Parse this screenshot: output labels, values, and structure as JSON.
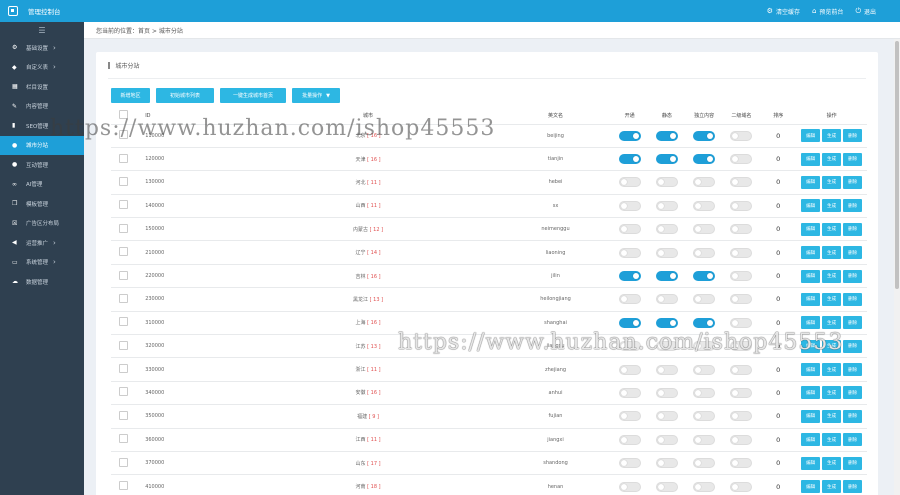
{
  "app": {
    "title": "管理控制台"
  },
  "top": {
    "items": [
      {
        "icon": "gear-icon",
        "label": "清空缓存"
      },
      {
        "icon": "home-icon",
        "label": "预览前台"
      },
      {
        "icon": "power-icon",
        "label": "退出"
      }
    ]
  },
  "sidebar": {
    "items": [
      {
        "icon": "gear-icon",
        "label": "基础设置",
        "arrow": true,
        "active": false
      },
      {
        "icon": "tag-icon",
        "label": "自定义表",
        "arrow": true,
        "active": false
      },
      {
        "icon": "grid-icon",
        "label": "栏目设置",
        "arrow": false,
        "active": false
      },
      {
        "icon": "edit-icon",
        "label": "内容管理",
        "arrow": false,
        "active": false
      },
      {
        "icon": "chart-icon",
        "label": "SEO管理",
        "arrow": false,
        "active": false
      },
      {
        "icon": "globe-icon",
        "label": "城市分站",
        "arrow": false,
        "active": true
      },
      {
        "icon": "comment-icon",
        "label": "互动管理",
        "arrow": false,
        "active": false
      },
      {
        "icon": "link-icon",
        "label": "AI管理",
        "arrow": false,
        "active": false
      },
      {
        "icon": "copy-icon",
        "label": "模板管理",
        "arrow": false,
        "active": false
      },
      {
        "icon": "close-box-icon",
        "label": "广告区分布局",
        "arrow": false,
        "active": false
      },
      {
        "icon": "megaphone-icon",
        "label": "运营推广",
        "arrow": true,
        "active": false
      },
      {
        "icon": "monitor-icon",
        "label": "系统管理",
        "arrow": true,
        "active": false
      },
      {
        "icon": "cloud-icon",
        "label": "数据管理",
        "arrow": false,
        "active": false
      }
    ]
  },
  "breadcrumb": "您当前的位置：首页 > 城市分站",
  "panel": {
    "title": "城市分站",
    "buttons": [
      "新增地区",
      "初始城市列表",
      "一键生成城市首页",
      "批量操作"
    ],
    "columns": [
      "ID",
      "城市",
      "英文名",
      "开通",
      "静态",
      "独立内容",
      "二级域名",
      "排序",
      "操作"
    ],
    "op_labels": [
      "编辑",
      "生成",
      "删除"
    ],
    "rows": [
      {
        "id": "110000",
        "name": "北京",
        "count": "16",
        "pinyin": "beijing",
        "open": true,
        "static": true,
        "indep": true,
        "sub": false,
        "sort": "0"
      },
      {
        "id": "120000",
        "name": "天津",
        "count": "16",
        "pinyin": "tianjin",
        "open": true,
        "static": true,
        "indep": true,
        "sub": false,
        "sort": "0"
      },
      {
        "id": "130000",
        "name": "河北",
        "count": "11",
        "pinyin": "hebei",
        "open": false,
        "static": false,
        "indep": false,
        "sub": false,
        "sort": "0"
      },
      {
        "id": "140000",
        "name": "山西",
        "count": "11",
        "pinyin": "sx",
        "open": false,
        "static": false,
        "indep": false,
        "sub": false,
        "sort": "0"
      },
      {
        "id": "150000",
        "name": "内蒙古",
        "count": "12",
        "pinyin": "neimenggu",
        "open": false,
        "static": false,
        "indep": false,
        "sub": false,
        "sort": "0"
      },
      {
        "id": "210000",
        "name": "辽宁",
        "count": "14",
        "pinyin": "liaoning",
        "open": false,
        "static": false,
        "indep": false,
        "sub": false,
        "sort": "0"
      },
      {
        "id": "220000",
        "name": "吉林",
        "count": "16",
        "pinyin": "jilin",
        "open": true,
        "static": true,
        "indep": true,
        "sub": false,
        "sort": "0"
      },
      {
        "id": "230000",
        "name": "黑龙江",
        "count": "13",
        "pinyin": "heilongjiang",
        "open": false,
        "static": false,
        "indep": false,
        "sub": false,
        "sort": "0"
      },
      {
        "id": "310000",
        "name": "上海",
        "count": "16",
        "pinyin": "shanghai",
        "open": true,
        "static": true,
        "indep": true,
        "sub": false,
        "sort": "0"
      },
      {
        "id": "320000",
        "name": "江苏",
        "count": "13",
        "pinyin": "jiangsu",
        "open": false,
        "static": false,
        "indep": false,
        "sub": false,
        "sort": "0"
      },
      {
        "id": "330000",
        "name": "浙江",
        "count": "11",
        "pinyin": "zhejiang",
        "open": false,
        "static": false,
        "indep": false,
        "sub": false,
        "sort": "0"
      },
      {
        "id": "340000",
        "name": "安徽",
        "count": "16",
        "pinyin": "anhui",
        "open": false,
        "static": false,
        "indep": false,
        "sub": false,
        "sort": "0"
      },
      {
        "id": "350000",
        "name": "福建",
        "count": "9",
        "pinyin": "fujian",
        "open": false,
        "static": false,
        "indep": false,
        "sub": false,
        "sort": "0"
      },
      {
        "id": "360000",
        "name": "江西",
        "count": "11",
        "pinyin": "jiangxi",
        "open": false,
        "static": false,
        "indep": false,
        "sub": false,
        "sort": "0"
      },
      {
        "id": "370000",
        "name": "山东",
        "count": "17",
        "pinyin": "shandong",
        "open": false,
        "static": false,
        "indep": false,
        "sub": false,
        "sort": "0"
      },
      {
        "id": "410000",
        "name": "河南",
        "count": "18",
        "pinyin": "henan",
        "open": false,
        "static": false,
        "indep": false,
        "sub": false,
        "sort": "0"
      }
    ]
  },
  "watermark": "https://www.huzhan.com/ishop45553"
}
